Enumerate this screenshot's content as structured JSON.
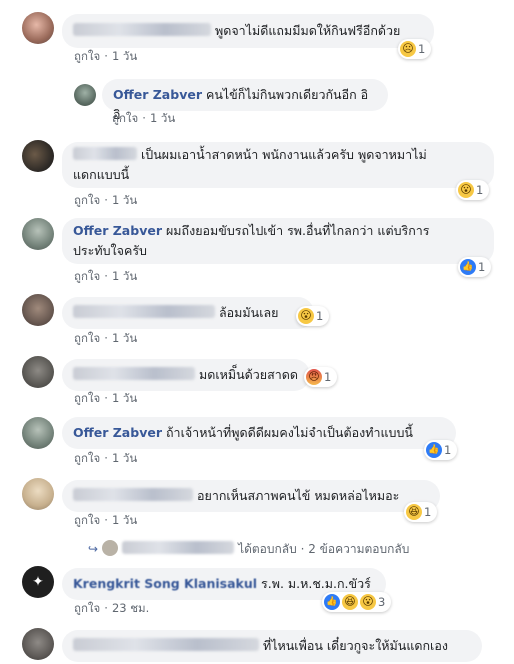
{
  "comments": [
    {
      "id": "c1",
      "name": "",
      "text": "พูดจาไม่ดีแถมมีมดให้กินฟรีอีกด้วย",
      "like": "ถูกใจ",
      "time": "1 วัน",
      "reaction_count": "1",
      "reactions": [
        "sad"
      ]
    },
    {
      "id": "c2",
      "name": "Offer Zabver",
      "text": "คนไข้ก็ไม่กินพวกเดียวกันอีก อิ อิ",
      "like": "ถูกใจ",
      "time": "1 วัน"
    },
    {
      "id": "c3",
      "name": "",
      "text_line1": "เป็นผมเอาน้ำสาดหน้า พนักงานแล้วครับ พูดจาหมาไม่",
      "text_line2": "แดกแบบนี้",
      "like": "ถูกใจ",
      "time": "1 วัน",
      "reaction_count": "1",
      "reactions": [
        "wow"
      ]
    },
    {
      "id": "c4",
      "name": "Offer Zabver",
      "text_line1": "ผมถึงยอมขับรถไปเข้า รพ.อื่นที่ไกลกว่า แต่บริการ",
      "text_line2": "ประทับใจครับ",
      "like": "ถูกใจ",
      "time": "1 วัน",
      "reaction_count": "1",
      "reactions": [
        "like"
      ]
    },
    {
      "id": "c5",
      "name": "",
      "text": "ล้อมมันเลย",
      "like": "ถูกใจ",
      "time": "1 วัน",
      "reaction_count": "1",
      "reactions": [
        "wow"
      ]
    },
    {
      "id": "c6",
      "name": "",
      "text": "มดเหมิ็นด้วยสาดด",
      "like": "ถูกใจ",
      "time": "1 วัน",
      "reaction_count": "1",
      "reactions": [
        "angry"
      ]
    },
    {
      "id": "c7",
      "name": "Offer Zabver",
      "text": "ถ้าเจ้าหน้าที่พูดดีดีผมคงไม่จำเป็นต้องทำแบบนี้",
      "like": "ถูกใจ",
      "time": "1 วัน",
      "reaction_count": "1",
      "reactions": [
        "like"
      ]
    },
    {
      "id": "c8",
      "name": "",
      "text": "อยากเห็นสภาพคนไข้ หมดหล่อไหมอะ",
      "like": "ถูกใจ",
      "time": "1 วัน",
      "reaction_count": "1",
      "reactions": [
        "haha"
      ]
    },
    {
      "id": "c9",
      "name": "Krengkrit Song Klanisakul",
      "text": "ร.พ. ม.ห.ช.ม.ก.ขัวร์",
      "like": "ถูกใจ",
      "time": "23 ชม.",
      "reaction_count": "3",
      "reactions": [
        "like",
        "haha",
        "wow"
      ]
    },
    {
      "id": "c10",
      "name": "",
      "text": "ที่ไหนเพื่อน เดี๋ยวกูจะให้มันแดกเอง"
    }
  ],
  "reply_link": {
    "replied": "ได้ตอบกลับ",
    "sep": "·",
    "count": "2 ข้อความตอบกลับ"
  },
  "ui": {
    "dot": "·"
  },
  "icons": {
    "sad": "sad-reaction-icon",
    "wow": "wow-reaction-icon",
    "like": "like-reaction-icon",
    "angry": "angry-reaction-icon",
    "haha": "haha-reaction-icon"
  }
}
